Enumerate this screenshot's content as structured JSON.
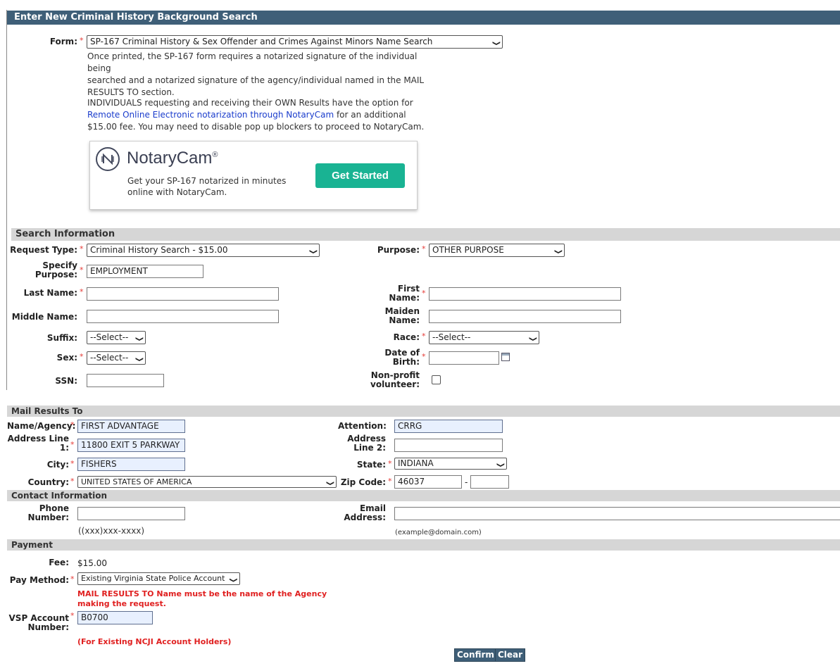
{
  "header": {
    "title": "Enter New Criminal History Background Search"
  },
  "form": {
    "label": "Form:",
    "selected": "SP-167 Criminal History & Sex Offender and Crimes Against Minors Name Search",
    "note_line1": "Once printed, the SP-167 form requires a notarized signature of the individual being",
    "note_line2": "searched and a notarized signature of the agency/individual named in the MAIL",
    "note_line3": "RESULTS TO section.",
    "individuals_line1": "INDIVIDUALS requesting and receiving their OWN Results have the option for",
    "link_text": "Remote Online Electronic notarization through NotaryCam",
    "individuals_line2_rest": " for an additional",
    "individuals_line3": "$15.00 fee. You may need to disable pop up blockers to proceed to NotaryCam."
  },
  "notarycam": {
    "brand": "NotaryCam",
    "reg": "®",
    "tagline1": "Get your SP-167 notarized in minutes",
    "tagline2": "online with NotaryCam.",
    "cta": "Get Started"
  },
  "search_info": {
    "title": "Search Information",
    "request_type_label": "Request Type:",
    "request_type_value": "Criminal History Search - $15.00",
    "purpose_label": "Purpose:",
    "purpose_value": "OTHER PURPOSE",
    "specify_label1": "Specify",
    "specify_label2": "Purpose:",
    "specify_value": "EMPLOYMENT",
    "last_name_label": "Last Name:",
    "first_name_label1": "First",
    "first_name_label2": "Name:",
    "middle_name_label": "Middle Name:",
    "maiden_label1": "Maiden",
    "maiden_label2": "Name:",
    "suffix_label": "Suffix:",
    "suffix_value": "--Select--",
    "race_label": "Race:",
    "race_value": "--Select--",
    "sex_label": "Sex:",
    "sex_value": "--Select--",
    "dob_label1": "Date of",
    "dob_label2": "Birth:",
    "ssn_label": "SSN:",
    "nonprofit_label1": "Non-profit",
    "nonprofit_label2": "volunteer:"
  },
  "mail": {
    "title": "Mail Results To",
    "name_label": "Name/Agency:",
    "name_value": "FIRST ADVANTAGE",
    "attention_label": "Attention:",
    "attention_value": "CRRG",
    "addr1_label1": "Address Line",
    "addr1_label2": "1:",
    "addr1_value": "11800 EXIT 5 PARKWAY",
    "addr2_label1": "Address",
    "addr2_label2": "Line 2:",
    "city_label": "City:",
    "city_value": "FISHERS",
    "state_label": "State:",
    "state_value": "INDIANA",
    "country_label": "Country:",
    "country_value": "UNITED STATES OF AMERICA",
    "zip_label": "Zip Code:",
    "zip_value": "46037",
    "zip_dash": "-"
  },
  "contact": {
    "title": "Contact Information",
    "phone_label1": "Phone",
    "phone_label2": "Number:",
    "phone_hint": "((xxx)xxx-xxxx)",
    "email_label1": "Email",
    "email_label2": "Address:",
    "email_hint": "(example@domain.com)"
  },
  "payment": {
    "title": "Payment",
    "fee_label": "Fee:",
    "fee_value": "$15.00",
    "method_label": "Pay Method:",
    "method_value": "Existing Virginia State Police Account",
    "warning1": "MAIL RESULTS TO Name must be the name of the Agency",
    "warning2": "making the request.",
    "acct_label1": "VSP Account",
    "acct_label2": "Number:",
    "acct_value": "B0700",
    "acct_note": "(For Existing NCJI Account Holders)"
  },
  "actions": {
    "confirm": "Confirm",
    "clear": "Clear"
  },
  "required_mark": "*"
}
